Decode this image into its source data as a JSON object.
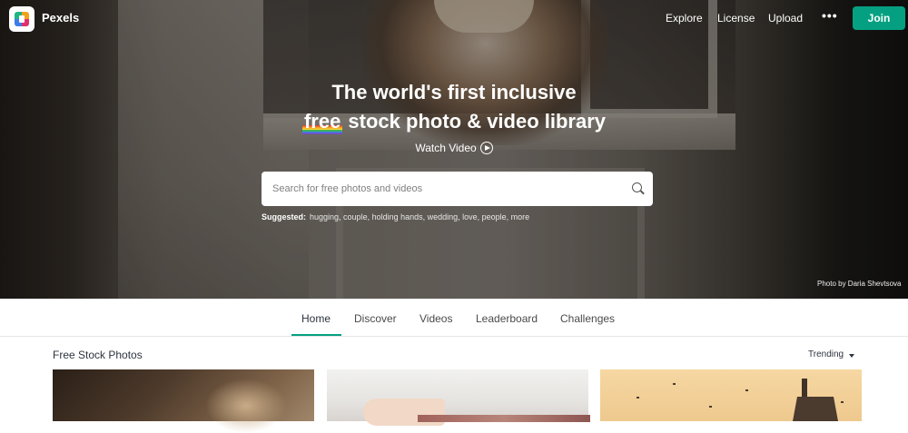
{
  "nav": {
    "brand": "Pexels",
    "links": [
      "Explore",
      "License",
      "Upload"
    ],
    "more": "•••",
    "join_label": "Join"
  },
  "hero": {
    "headline_line1": "The world's first inclusive",
    "headline_free": "free",
    "headline_line2_rest": " stock photo & video library",
    "watch_video": "Watch Video",
    "search": {
      "placeholder": "Search for free photos and videos"
    },
    "suggested_label": "Suggested:",
    "suggested_tags": "hugging, couple, holding hands, wedding, love, people, more",
    "photo_credit": "Photo by Daria Shevtsova"
  },
  "tabs": [
    "Home",
    "Discover",
    "Videos",
    "Leaderboard",
    "Challenges"
  ],
  "active_tab": "Home",
  "feed": {
    "title": "Free Stock Photos",
    "sort_label": "Trending"
  },
  "colors": {
    "accent": "#05a081",
    "text": "#2c343e"
  }
}
